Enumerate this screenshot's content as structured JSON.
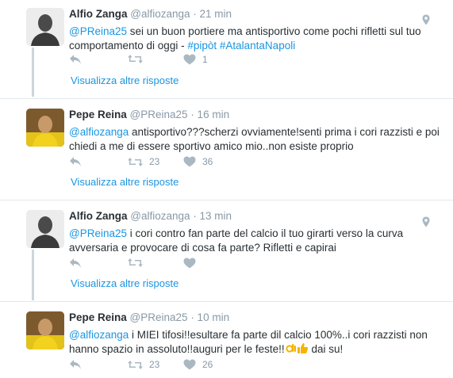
{
  "tweets": [
    {
      "name": "Alfio Zanga",
      "handle": "@alfiozanga",
      "time": "· 21 min",
      "mention": "@PReina25",
      "body": " sei un buon portiere ma antisportivo come pochi rifletti sul tuo comportamento di oggi - ",
      "hashtag1": "#pipòt",
      "hashtag2": "#AtalantaNapoli",
      "likes": "1",
      "more": "Visualizza altre risposte"
    },
    {
      "name": "Pepe Reina",
      "handle": "@PReina25",
      "time": "· 16 min",
      "mention": "@alfiozanga",
      "body": " antisportivo???scherzi ovviamente!senti prima i cori razzisti e poi chiedi a me di essere sportivo amico mio..non esiste proprio",
      "retweets": "23",
      "likes": "36",
      "more": "Visualizza altre risposte"
    },
    {
      "name": "Alfio Zanga",
      "handle": "@alfiozanga",
      "time": "· 13 min",
      "mention": "@PReina25",
      "body": " i cori contro fan parte del calcio il tuo girarti verso la curva avversaria e provocare di cosa fa parte? Rifletti e capirai",
      "more": "Visualizza altre risposte"
    },
    {
      "name": "Pepe Reina",
      "handle": "@PReina25",
      "time": "· 10 min",
      "mention": "@alfiozanga",
      "body": " i MIEI tifosi!!esultare fa parte dil calcio 100%..i cori razzisti non hanno spazio in assoluto!!auguri per le feste!!",
      "body_end": " dai su!",
      "retweets": "23",
      "likes": "26"
    }
  ],
  "icons": [
    "reply-icon",
    "retweet-icon",
    "like-icon",
    "location-icon",
    "ok-hand-emoji",
    "thumbs-up-emoji"
  ],
  "colors": {
    "link": "#1b95e0",
    "muted": "#8899a6",
    "text": "#292f33",
    "thread": "#ccd6dd"
  }
}
